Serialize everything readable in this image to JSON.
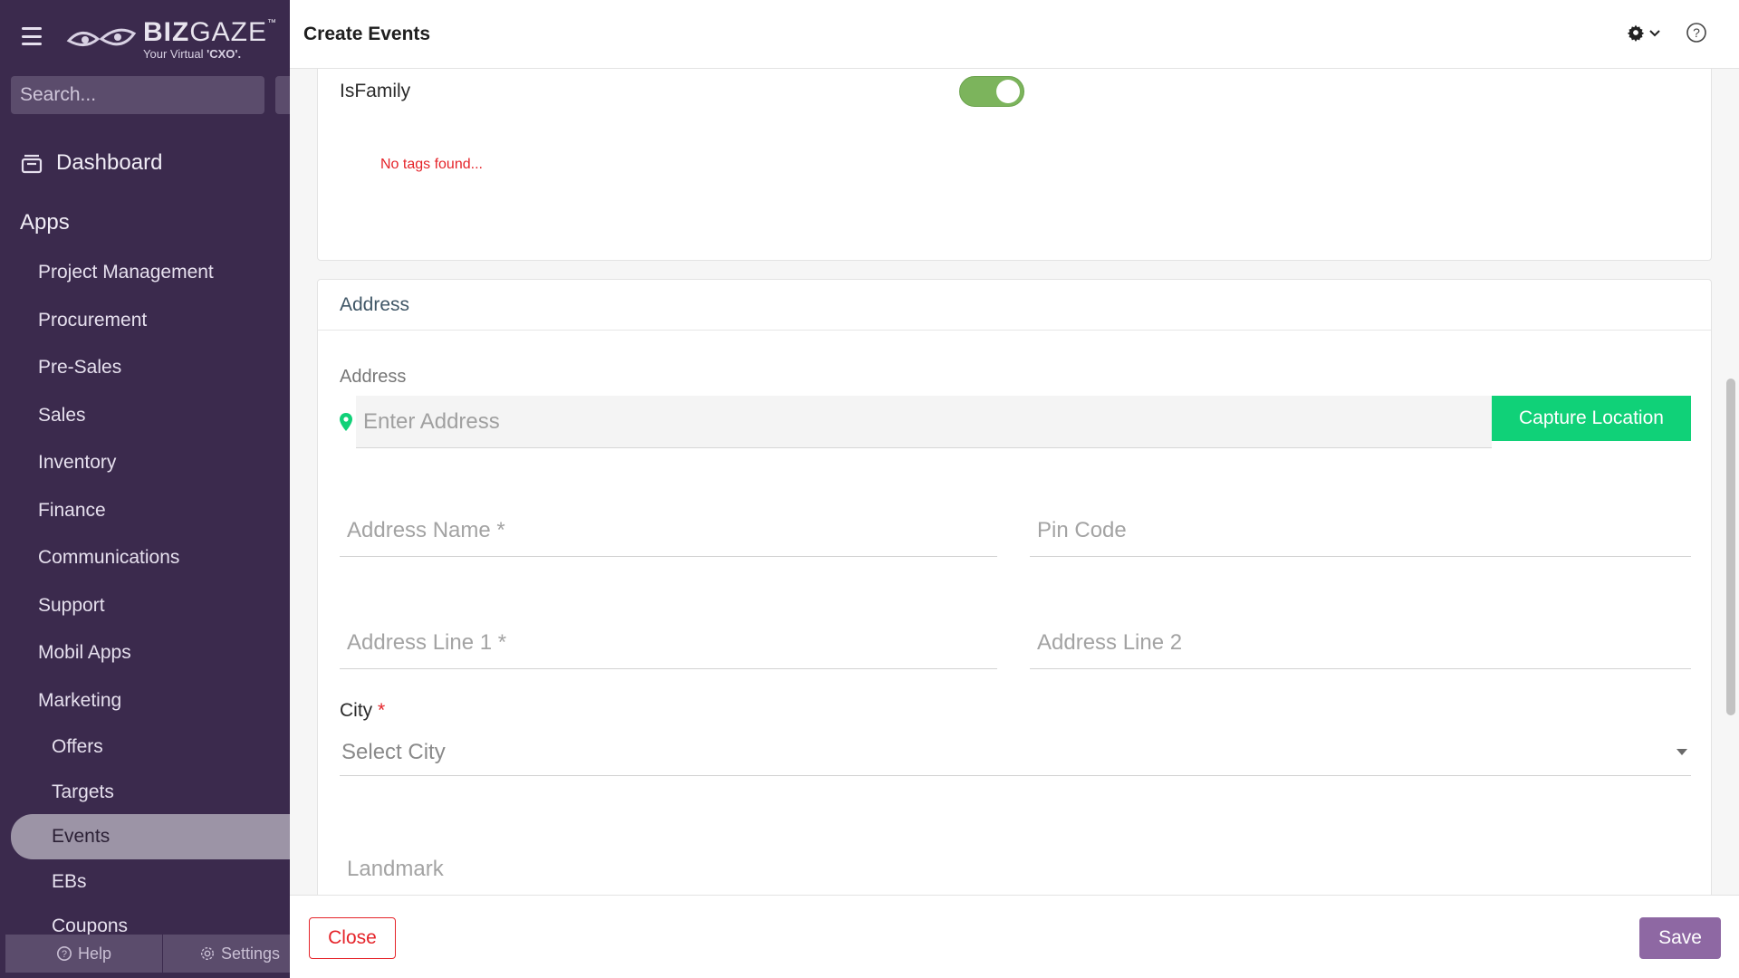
{
  "app": {
    "logo_main_bold": "BIZ",
    "logo_main": "GAZE",
    "logo_tm": "™",
    "logo_sub": "Your Virtual ",
    "logo_sub_bold": "'CXO'."
  },
  "sidebar": {
    "search_placeholder": "Search...",
    "dashboard_label": "Dashboard",
    "apps_label": "Apps",
    "items": [
      {
        "label": "Project Management"
      },
      {
        "label": "Procurement"
      },
      {
        "label": "Pre-Sales"
      },
      {
        "label": "Sales"
      },
      {
        "label": "Inventory"
      },
      {
        "label": "Finance"
      },
      {
        "label": "Communications"
      },
      {
        "label": "Support"
      },
      {
        "label": "Mobil Apps"
      },
      {
        "label": "Marketing"
      }
    ],
    "sub_items": [
      {
        "label": "Offers"
      },
      {
        "label": "Targets"
      },
      {
        "label": "Events",
        "active": true
      },
      {
        "label": "EBs"
      },
      {
        "label": "Coupons"
      }
    ],
    "footer": {
      "help_label": "Help",
      "settings_label": "Settings"
    }
  },
  "header": {
    "title": "Create Events"
  },
  "form": {
    "isfamily_label": "IsFamily",
    "isfamily_on": true,
    "no_tags_text": "No tags found...",
    "address_section_title": "Address",
    "address_label": "Address",
    "address_placeholder": "Enter Address",
    "capture_location_label": "Capture Location",
    "address_name_placeholder": "Address Name *",
    "pin_code_placeholder": "Pin Code",
    "address_line1_placeholder": "Address Line 1 *",
    "address_line2_placeholder": "Address Line 2",
    "city_label": "City",
    "city_required_mark": "*",
    "city_placeholder": "Select City",
    "landmark_placeholder": "Landmark"
  },
  "footer": {
    "close_label": "Close",
    "save_label": "Save"
  },
  "colors": {
    "sidebar_bg": "#3b2a4d",
    "accent_green": "#10d178",
    "toggle_green": "#7cb45c",
    "save_purple": "#8e68a3",
    "error_red": "#e5242a"
  }
}
